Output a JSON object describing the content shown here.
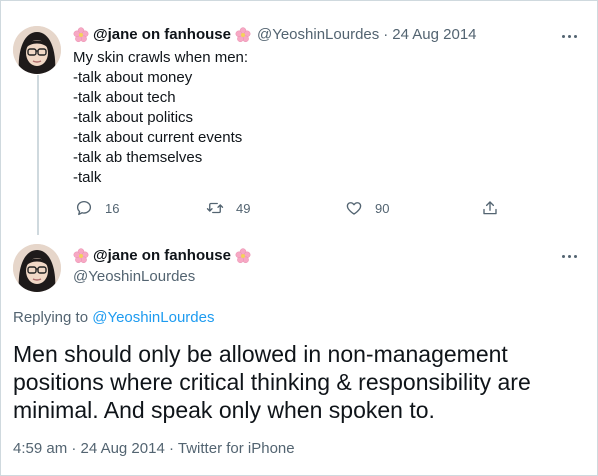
{
  "tweet1": {
    "name": "@jane on fanhouse",
    "handle": "@YeoshinLourdes",
    "sep": "·",
    "date": "24 Aug 2014",
    "text": "My skin crawls when men:\n-talk about money\n-talk about tech\n-talk about politics\n-talk about current events\n-talk ab themselves\n-talk",
    "replies": "16",
    "retweets": "49",
    "likes": "90"
  },
  "tweet2": {
    "name": "@jane on fanhouse",
    "handle": "@YeoshinLourdes",
    "replying_prefix": "Replying to",
    "replying_handle": "@YeoshinLourdes",
    "text": "Men should only be allowed in non-management positions where critical thinking & responsibility are minimal. And speak only when spoken to.",
    "time": "4:59 am",
    "sep": "·",
    "date": "24 Aug 2014",
    "source": "Twitter for iPhone"
  },
  "colors": {
    "text": "#0f1419",
    "secondary": "#536471",
    "link": "#1d9bf0",
    "border": "#cfd9de"
  },
  "icons": [
    "cherry-blossom-icon",
    "more-icon",
    "reply-icon",
    "retweet-icon",
    "like-icon",
    "share-icon"
  ]
}
